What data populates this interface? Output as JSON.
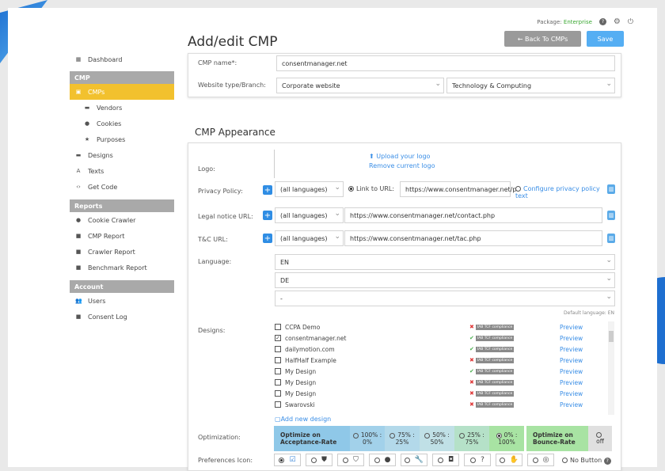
{
  "top": {
    "package_label": "Package:",
    "package_value": "Enterprise"
  },
  "page": {
    "title": "Add/edit CMP",
    "back": "← Back To CMPs",
    "save": "Save"
  },
  "sidebar": {
    "dashboard": "Dashboard",
    "cmp_header": "CMP",
    "cmps": "CMPs",
    "vendors": "Vendors",
    "cookies": "Cookies",
    "purposes": "Purposes",
    "designs": "Designs",
    "texts": "Texts",
    "getcode": "Get Code",
    "reports_header": "Reports",
    "crawler": "Cookie Crawler",
    "cmpreport": "CMP Report",
    "crawlerreport": "Crawler Report",
    "benchmark": "Benchmark Report",
    "account_header": "Account",
    "users": "Users",
    "consentlog": "Consent Log"
  },
  "form": {
    "name_label": "CMP name*:",
    "name_value": "consentmanager.net",
    "type_label": "Website type/Branch:",
    "type_value": "Corporate website",
    "branch_value": "Technology & Computing"
  },
  "appearance": {
    "title": "CMP Appearance",
    "logo_label": "Logo:",
    "upload": "Upload your logo",
    "remove": "Remove current logo",
    "privacy_label": "Privacy Policy:",
    "all_lang": "(all languages)",
    "link_url": "Link to URL:",
    "privacy_url": "https://www.consentmanager.net/p",
    "configure": "Configure privacy policy text",
    "legal_label": "Legal notice URL:",
    "legal_url": "https://www.consentmanager.net/contact.php",
    "tc_label": "T&C URL:",
    "tc_url": "https://www.consentmanager.net/tac.php",
    "lang_label": "Language:",
    "lang1": "EN",
    "lang2": "DE",
    "lang3": "-",
    "default_lang": "Default language: EN",
    "designs_label": "Designs:",
    "add_design": "Add new design",
    "tcf": "IAB TCF compliance",
    "preview": "Preview",
    "designs": [
      "CCPA Demo",
      "consentmanager.net",
      "dailymotion.com",
      "HalfHalf Example",
      "My Design",
      "My Design",
      "My Design",
      "Swarovski"
    ],
    "opt_label": "Optimization:",
    "opt_left": "Optimize on Acceptance-Rate",
    "opt_right": "Optimize on Bounce-Rate",
    "opt_vals": [
      [
        "100% :",
        "0%"
      ],
      [
        "75% :",
        "25%"
      ],
      [
        "50% :",
        "50%"
      ],
      [
        "25% :",
        "75%"
      ],
      [
        "0% :",
        "100%"
      ]
    ],
    "opt_off": "off",
    "pref_label": "Preferences Icon:",
    "no_button": "No Button"
  }
}
